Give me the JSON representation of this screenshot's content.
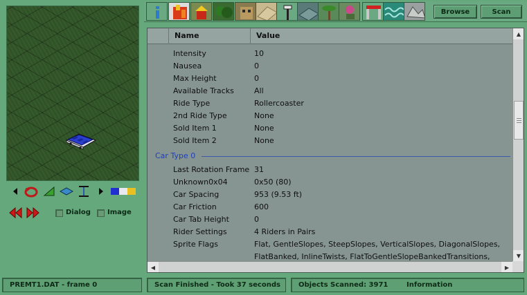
{
  "tabs": [
    {
      "name": "info",
      "active": false
    },
    {
      "name": "ride",
      "active": true
    },
    {
      "name": "stall",
      "active": false
    },
    {
      "name": "scenery-trees",
      "active": false
    },
    {
      "name": "building",
      "active": false
    },
    {
      "name": "path",
      "active": false
    },
    {
      "name": "path-items",
      "active": false
    },
    {
      "name": "walls",
      "active": false
    },
    {
      "name": "banners",
      "active": false
    },
    {
      "name": "scenery-group",
      "active": false
    },
    {
      "name": "entrance",
      "active": false
    },
    {
      "name": "water",
      "active": false
    },
    {
      "name": "terrain",
      "active": false
    }
  ],
  "toolbar": {
    "browse_label": "Browse",
    "scan_label": "Scan"
  },
  "left_panel": {
    "dialog_label": "Dialog",
    "image_label": "Image"
  },
  "table": {
    "col_name": "Name",
    "col_value": "Value",
    "rows_a": [
      {
        "name": "Intensity",
        "value": "10"
      },
      {
        "name": "Nausea",
        "value": "0"
      },
      {
        "name": "Max Height",
        "value": "0"
      },
      {
        "name": "Available Tracks",
        "value": "All"
      },
      {
        "name": "Ride Type",
        "value": "Rollercoaster"
      },
      {
        "name": "2nd Ride Type",
        "value": "None"
      },
      {
        "name": "Sold Item 1",
        "value": "None"
      },
      {
        "name": "Sold Item 2",
        "value": "None"
      }
    ],
    "group_label": "Car Type 0",
    "rows_b": [
      {
        "name": "Last Rotation Frame",
        "value": "31"
      },
      {
        "name": "Unknown0x04",
        "value": "0x50 (80)"
      },
      {
        "name": "Car Spacing",
        "value": "953 (9.53 ft)"
      },
      {
        "name": "Car Friction",
        "value": "600"
      },
      {
        "name": "Car Tab Height",
        "value": "0"
      },
      {
        "name": "Rider Settings",
        "value": "4 Riders in Pairs"
      },
      {
        "name": "Sprite Flags",
        "value": "Flat, GentleSlopes, SteepSlopes, VerticalSlopes, DiagonalSlopes,"
      },
      {
        "name": "",
        "value": "FlatBanked, InlineTwists, FlatToGentleSlopeBankedTransitions,"
      }
    ]
  },
  "status": {
    "file": "PREMT1.DAT - frame 0",
    "scan": "Scan Finished - Took 37 seconds",
    "objects": "Objects Scanned: 3971",
    "info": "Information"
  }
}
